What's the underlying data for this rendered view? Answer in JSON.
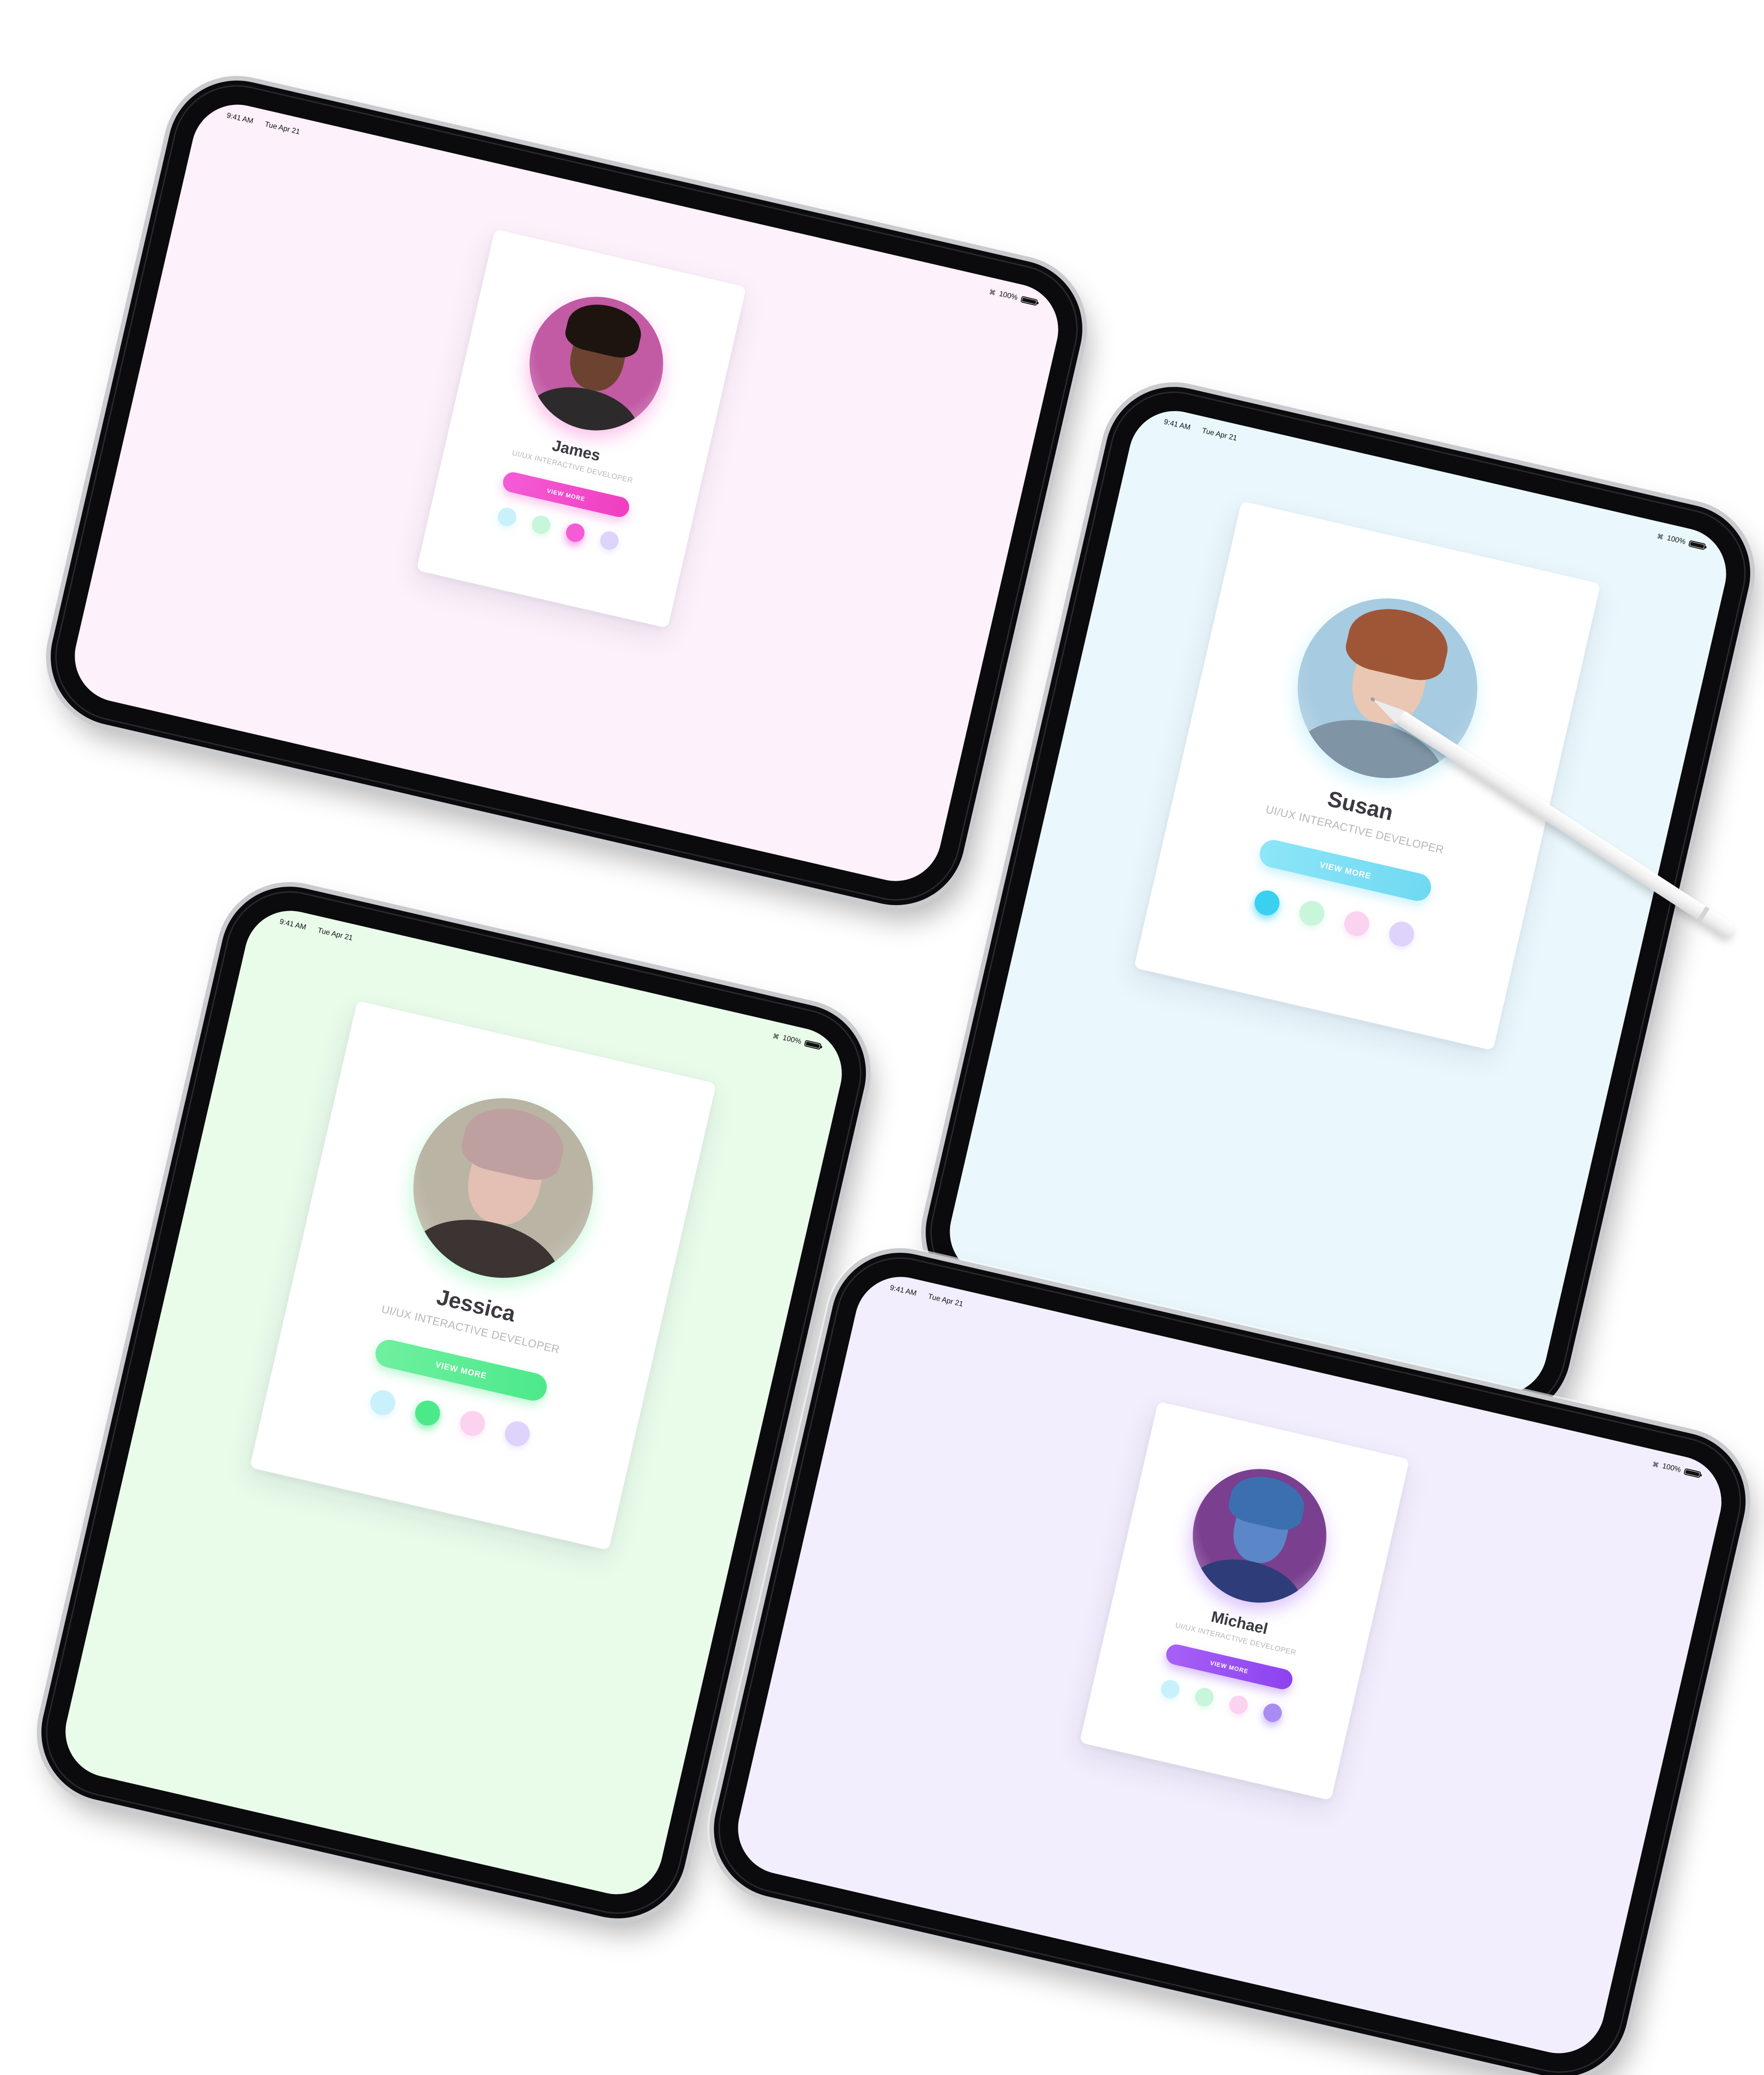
{
  "status_bar": {
    "time": "9:41 AM",
    "date": "Tue Apr 21",
    "battery": "100%"
  },
  "devices": [
    {
      "id": "james",
      "screen_color": "#fdf1fb",
      "profile": {
        "name": "James",
        "role": "UI/UX INTERACTIVE DEVELOPER",
        "button_label": "VIEW MORE",
        "accent": "#f03ec0",
        "avatar": {
          "skin": "#6b4330",
          "hair": "#1d1410",
          "clothes": "#2d2a2b",
          "background": "#c25aa4"
        },
        "swatches": [
          "#c9f1fb",
          "#c7f6da",
          "#f55bd6",
          "#ded3fb"
        ],
        "active_swatch": 2
      }
    },
    {
      "id": "susan",
      "screen_color": "#eaf8fd",
      "profile": {
        "name": "Susan",
        "role": "UI/UX INTERACTIVE DEVELOPER",
        "button_label": "VIEW MORE",
        "accent": "#6fd9f2",
        "avatar": {
          "skin": "#e9c7b3",
          "hair": "#9e5636",
          "clothes": "#7f95a6",
          "background": "#a7cbe0"
        },
        "swatches": [
          "#3ad1f0",
          "#c7f6da",
          "#fbd2f0",
          "#ded3fb"
        ],
        "active_swatch": 0
      }
    },
    {
      "id": "jessica",
      "screen_color": "#e9fcea",
      "profile": {
        "name": "Jessica",
        "role": "UI/UX INTERACTIVE DEVELOPER",
        "button_label": "VIEW MORE",
        "accent": "#4ce98a",
        "avatar": {
          "skin": "#e4bfb4",
          "hair": "#bfa0a0",
          "clothes": "#3b3432",
          "background": "#b9b4a4"
        },
        "swatches": [
          "#c9f1fb",
          "#4ce98a",
          "#fbd2f0",
          "#ded3fb"
        ],
        "active_swatch": 1
      }
    },
    {
      "id": "michael",
      "screen_color": "#f2eefd",
      "profile": {
        "name": "Michael",
        "role": "UI/UX INTERACTIVE DEVELOPER",
        "button_label": "VIEW MORE",
        "accent": "#8d42f0",
        "avatar": {
          "skin": "#5b86c8",
          "hair": "#3c6fb0",
          "clothes": "#2e3d7a",
          "background": "#7a3f8f"
        },
        "swatches": [
          "#c9f1fb",
          "#c7f6da",
          "#fbd2f0",
          "#a98cf2"
        ],
        "active_swatch": 3
      }
    }
  ]
}
